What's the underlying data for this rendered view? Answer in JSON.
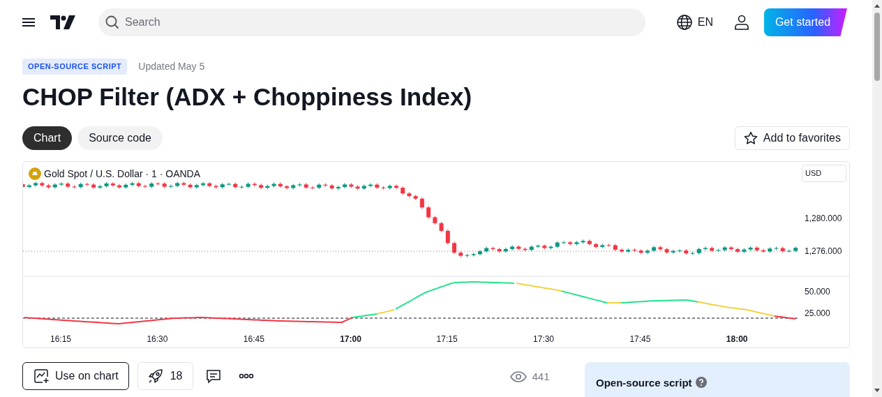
{
  "header": {
    "search_placeholder": "Search",
    "language": "EN",
    "cta": "Get started"
  },
  "badge": "OPEN-SOURCE SCRIPT",
  "updated": "Updated May 5",
  "title": "CHOP Filter (ADX + Choppiness Index)",
  "tabs": [
    {
      "label": "Chart",
      "selected": true
    },
    {
      "label": "Source code",
      "selected": false
    }
  ],
  "favorites": "Add to favorites",
  "chart": {
    "symbol": "Gold Spot / U.S. Dollar · 1 · OANDA",
    "currency": "USD",
    "price_ticks": [
      "1,280.000",
      "1,276.000"
    ],
    "indicator_ticks": [
      "50.000",
      "25.000"
    ],
    "time_ticks": [
      {
        "label": "16:15",
        "bold": false
      },
      {
        "label": "16:30",
        "bold": false
      },
      {
        "label": "16:45",
        "bold": false
      },
      {
        "label": "17:00",
        "bold": true
      },
      {
        "label": "17:15",
        "bold": false
      },
      {
        "label": "17:30",
        "bold": false
      },
      {
        "label": "17:45",
        "bold": false
      },
      {
        "label": "18:00",
        "bold": true
      }
    ]
  },
  "actions": {
    "use_on_chart": "Use on chart",
    "boosts": "18",
    "views": "441"
  },
  "info_card": {
    "title": "Open-source script"
  }
}
